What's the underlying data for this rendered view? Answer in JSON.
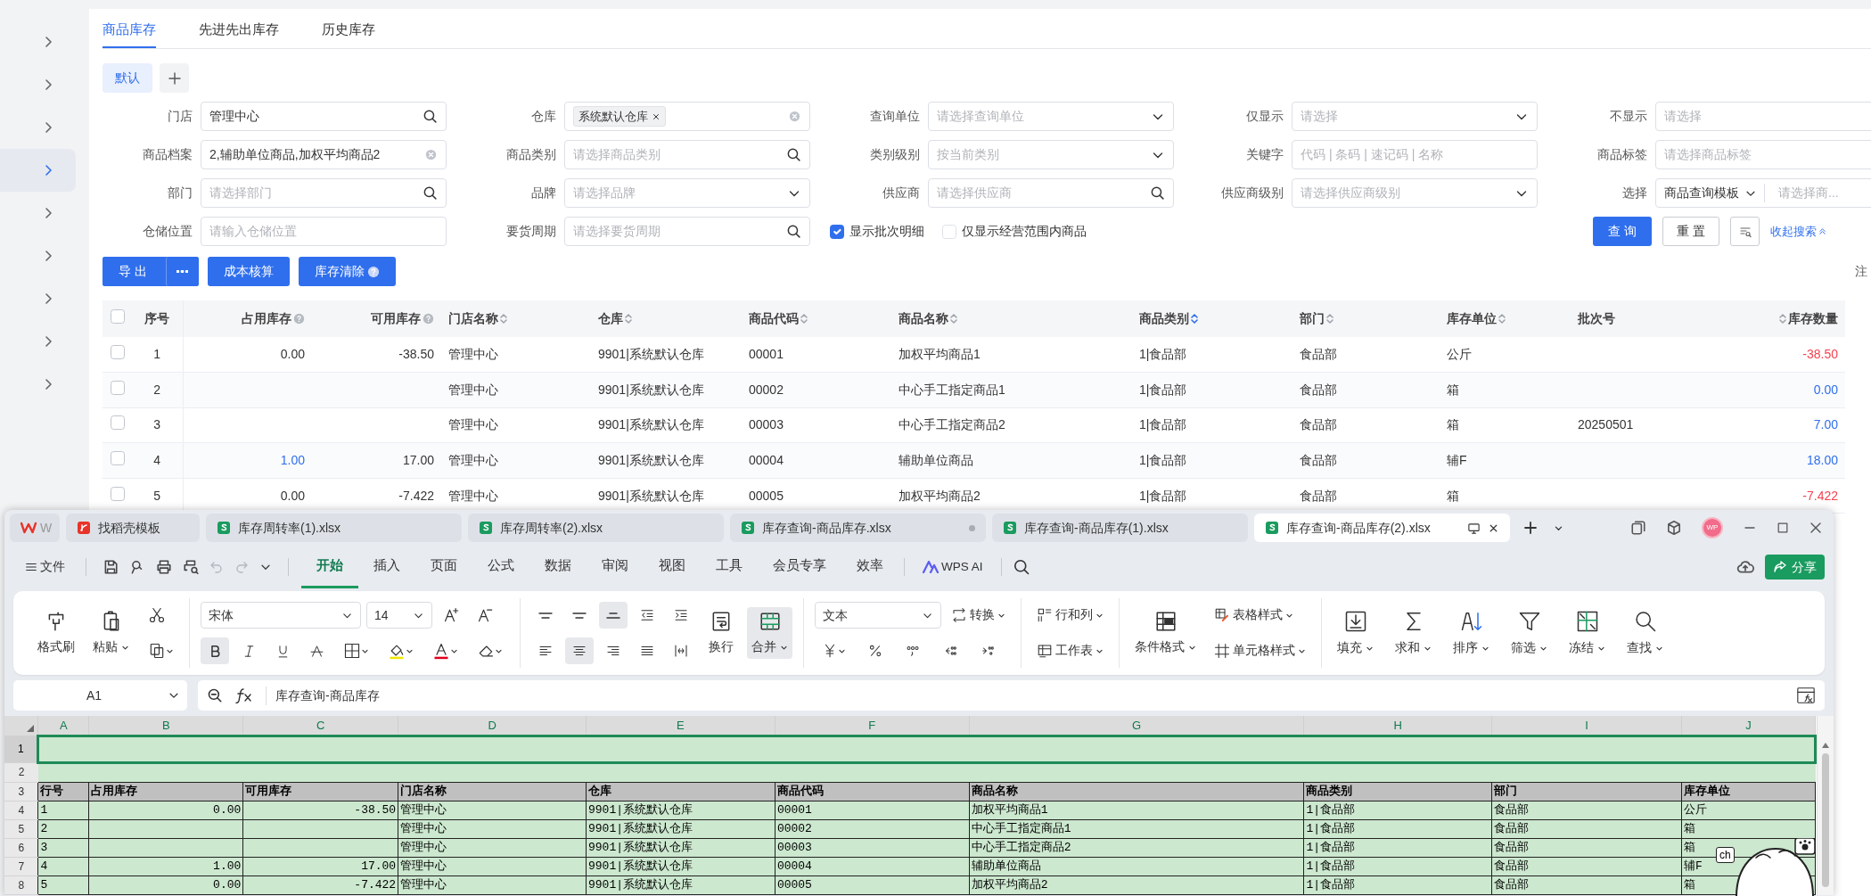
{
  "erp": {
    "sidebar": {
      "items": [
        {
          "selected": false
        },
        {
          "selected": false
        },
        {
          "selected": false
        },
        {
          "selected": true
        },
        {
          "selected": false
        },
        {
          "selected": false
        },
        {
          "selected": false
        },
        {
          "selected": false
        },
        {
          "selected": false
        }
      ]
    },
    "tabs": [
      {
        "label": "商品库存",
        "selected": true
      },
      {
        "label": "先进先出库存",
        "selected": false
      },
      {
        "label": "历史库存",
        "selected": false
      }
    ],
    "presets": [
      {
        "label": "默认",
        "selected": true
      }
    ],
    "filter_rows": [
      [
        {
          "label": "门店",
          "kind": "search",
          "value": "管理中心"
        },
        {
          "label": "仓库",
          "kind": "tags",
          "tags": [
            "系统默认仓库"
          ]
        },
        {
          "label": "查询单位",
          "kind": "select",
          "placeholder": "请选择查询单位"
        },
        {
          "label": "仅显示",
          "kind": "select",
          "placeholder": "请选择"
        },
        {
          "label": "不显示",
          "kind": "text",
          "placeholder": "请选择"
        }
      ],
      [
        {
          "label": "商品档案",
          "kind": "clearable",
          "value": "2,辅助单位商品,加权平均商品2"
        },
        {
          "label": "商品类别",
          "kind": "search",
          "placeholder": "请选择商品类别"
        },
        {
          "label": "类别级别",
          "kind": "select",
          "placeholder": "按当前类别"
        },
        {
          "label": "关键字",
          "kind": "text",
          "placeholder": "代码 | 条码 | 速记码 | 名称"
        },
        {
          "label": "商品标签",
          "kind": "text",
          "placeholder": "请选择商品标签"
        }
      ],
      [
        {
          "label": "部门",
          "kind": "search",
          "placeholder": "请选择部门"
        },
        {
          "label": "品牌",
          "kind": "select",
          "placeholder": "请选择品牌"
        },
        {
          "label": "供应商",
          "kind": "search",
          "placeholder": "请选择供应商"
        },
        {
          "label": "供应商级别",
          "kind": "select",
          "placeholder": "请选择供应商级别"
        },
        {
          "label": "选择",
          "kind": "combo",
          "value": "商品查询模板",
          "placeholder": "请选择商..."
        }
      ],
      [
        {
          "label": "仓储位置",
          "kind": "text",
          "placeholder": "请输入仓储位置"
        },
        {
          "label": "要货周期",
          "kind": "search",
          "placeholder": "请选择要货周期"
        }
      ]
    ],
    "options": [
      {
        "label": "显示批次明细",
        "checked": true
      },
      {
        "label": "仅显示经营范围内商品",
        "checked": false
      }
    ],
    "query_button": "查 询",
    "reset_button": "重 置",
    "collapse_link": "收起搜索",
    "actions": [
      {
        "label": "导 出",
        "kind": "split"
      },
      {
        "label": "成本核算",
        "kind": "plain"
      },
      {
        "label": "库存清除",
        "kind": "help"
      }
    ],
    "note": "注",
    "table": {
      "all_checked": false,
      "columns": [
        {
          "label": "序号",
          "kind": "index",
          "sortable": false
        },
        {
          "label": "占用库存",
          "kind": "number",
          "help": true,
          "sortable": false
        },
        {
          "label": "可用库存",
          "kind": "number",
          "help": true,
          "sortable": false
        },
        {
          "label": "门店名称",
          "kind": "text",
          "sortable": true,
          "sorted": false
        },
        {
          "label": "仓库",
          "kind": "text",
          "sortable": true,
          "sorted": false
        },
        {
          "label": "商品代码",
          "kind": "text",
          "sortable": true,
          "sorted": false
        },
        {
          "label": "商品名称",
          "kind": "text",
          "sortable": true,
          "sorted": false
        },
        {
          "label": "商品类别",
          "kind": "text",
          "sortable": true,
          "sorted": true
        },
        {
          "label": "部门",
          "kind": "text",
          "sortable": true,
          "sorted": false
        },
        {
          "label": "库存单位",
          "kind": "text",
          "sortable": true,
          "sorted": false
        },
        {
          "label": "批次号",
          "kind": "text",
          "sortable": false
        },
        {
          "label": "库存数量",
          "kind": "number",
          "sortable": true,
          "sorted": false
        }
      ],
      "rows": [
        {
          "checked": false,
          "cells": [
            "1",
            "0.00",
            "-38.50",
            "管理中心",
            "9901|系统默认仓库",
            "00001",
            "加权平均商品1",
            "1|食品部",
            "食品部",
            "公斤",
            null,
            {
              "text": "-38.50",
              "color": "#f5424f"
            }
          ]
        },
        {
          "checked": false,
          "cells": [
            "2",
            null,
            null,
            "管理中心",
            "9901|系统默认仓库",
            "00002",
            "中心手工指定商品1",
            "1|食品部",
            "食品部",
            "箱",
            null,
            {
              "text": "0.00",
              "color": "#2f6fed"
            }
          ]
        },
        {
          "checked": false,
          "cells": [
            "3",
            null,
            null,
            "管理中心",
            "9901|系统默认仓库",
            "00003",
            "中心手工指定商品2",
            "1|食品部",
            "食品部",
            "箱",
            "20250501",
            {
              "text": "7.00",
              "color": "#2f6fed"
            }
          ]
        },
        {
          "checked": false,
          "cells": [
            "4",
            {
              "text": "1.00",
              "color": "#2f6fed"
            },
            "17.00",
            "管理中心",
            "9901|系统默认仓库",
            "00004",
            "辅助单位商品",
            "1|食品部",
            "食品部",
            "辅F",
            null,
            {
              "text": "18.00",
              "color": "#2f6fed"
            }
          ]
        },
        {
          "checked": false,
          "cells": [
            "5",
            "0.00",
            "-7.422",
            "管理中心",
            "9901|系统默认仓库",
            "00005",
            "加权平均商品2",
            "1|食品部",
            "食品部",
            "箱",
            null,
            {
              "text": "-7.422",
              "color": "#f5424f"
            }
          ]
        }
      ]
    }
  },
  "wps": {
    "doc_tabs": [
      {
        "label": "W",
        "kind": "home",
        "selected": false
      },
      {
        "label": "找稻壳模板",
        "kind": "template",
        "selected": false
      },
      {
        "label": "库存周转率(1).xlsx",
        "kind": "sheet",
        "selected": false,
        "unsaved": false
      },
      {
        "label": "库存周转率(2).xlsx",
        "kind": "sheet",
        "selected": false,
        "unsaved": false
      },
      {
        "label": "库存查询-商品库存.xlsx",
        "kind": "sheet",
        "selected": false,
        "unsaved": true
      },
      {
        "label": "库存查询-商品库存(1).xlsx",
        "kind": "sheet",
        "selected": false,
        "unsaved": false
      },
      {
        "label": "库存查询-商品库存(2).xlsx",
        "kind": "sheet",
        "selected": true,
        "unsaved": false
      }
    ],
    "avatar": "WP",
    "file_menu": "文件",
    "menu": [
      {
        "label": "开始",
        "selected": true
      },
      {
        "label": "插入",
        "selected": false
      },
      {
        "label": "页面",
        "selected": false
      },
      {
        "label": "公式",
        "selected": false
      },
      {
        "label": "数据",
        "selected": false
      },
      {
        "label": "审阅",
        "selected": false
      },
      {
        "label": "视图",
        "selected": false
      },
      {
        "label": "工具",
        "selected": false
      },
      {
        "label": "会员专享",
        "selected": false
      },
      {
        "label": "效率",
        "selected": false
      }
    ],
    "ai": "WPS AI",
    "share": "分享",
    "ribbon": {
      "clipboard": [
        {
          "label": "格式刷",
          "kind": "brush"
        },
        {
          "label": "粘贴",
          "kind": "paste"
        }
      ],
      "font": "宋体",
      "size": "14",
      "styles": [
        {
          "kind": "bold",
          "on": true
        },
        {
          "kind": "italic",
          "on": false
        },
        {
          "kind": "underline",
          "on": false
        },
        {
          "kind": "strike",
          "on": false
        }
      ],
      "valign": [
        {
          "kind": "top",
          "on": false
        },
        {
          "kind": "middle",
          "on": false
        },
        {
          "kind": "bottom",
          "on": true
        }
      ],
      "halign": [
        {
          "kind": "left",
          "on": false
        },
        {
          "kind": "center",
          "on": true
        },
        {
          "kind": "right",
          "on": false
        },
        {
          "kind": "justify",
          "on": false
        }
      ],
      "wrap": "换行",
      "merge": {
        "label": "合并",
        "on": true
      },
      "number_format": "文本",
      "convert": "转换",
      "rows_cols": "行和列",
      "worksheet": "工作表",
      "cond_format": "条件格式",
      "table_style": "表格样式",
      "cell_style": "单元格样式",
      "tools": [
        {
          "label": "填充",
          "kind": "fill"
        },
        {
          "label": "求和",
          "kind": "sum"
        },
        {
          "label": "排序",
          "kind": "sort"
        },
        {
          "label": "筛选",
          "kind": "filter"
        },
        {
          "label": "冻结",
          "kind": "freeze"
        },
        {
          "label": "查找",
          "kind": "find"
        }
      ]
    },
    "name_box": "A1",
    "formula": "库存查询-商品库存",
    "sheet": {
      "columns": [
        "A",
        "B",
        "C",
        "D",
        "E",
        "F",
        "G",
        "H",
        "I",
        "J"
      ],
      "rows": [
        {
          "number": "1",
          "kind": "title",
          "selected": true
        },
        {
          "number": "2",
          "kind": "blank",
          "selected": false
        },
        {
          "number": "3",
          "kind": "header",
          "selected": false,
          "cells": [
            "行号",
            "占用库存",
            "可用库存",
            "门店名称",
            "仓库",
            "商品代码",
            "商品名称",
            "商品类别",
            "部门",
            "库存单位"
          ]
        },
        {
          "number": "4",
          "kind": "data",
          "selected": false,
          "cells": [
            "1",
            "0.00",
            "-38.50",
            "管理中心",
            "9901|系统默认仓库",
            "00001",
            "加权平均商品1",
            "1|食品部",
            "食品部",
            "公斤"
          ]
        },
        {
          "number": "5",
          "kind": "data",
          "selected": false,
          "cells": [
            "2",
            null,
            null,
            "管理中心",
            "9901|系统默认仓库",
            "00002",
            "中心手工指定商品1",
            "1|食品部",
            "食品部",
            "箱"
          ]
        },
        {
          "number": "6",
          "kind": "data",
          "selected": false,
          "cells": [
            "3",
            null,
            null,
            "管理中心",
            "9901|系统默认仓库",
            "00003",
            "中心手工指定商品2",
            "1|食品部",
            "食品部",
            "箱"
          ]
        },
        {
          "number": "7",
          "kind": "data",
          "selected": false,
          "cells": [
            "4",
            "1.00",
            "17.00",
            "管理中心",
            "9901|系统默认仓库",
            "00004",
            "辅助单位商品",
            "1|食品部",
            "食品部",
            "辅F"
          ]
        },
        {
          "number": "8",
          "kind": "data",
          "selected": false,
          "cells": [
            "5",
            "0.00",
            "-7.422",
            "管理中心",
            "9901|系统默认仓库",
            "00005",
            "加权平均商品2",
            "1|食品部",
            "食品部",
            "箱"
          ]
        }
      ]
    },
    "pet_badge": "ch"
  }
}
